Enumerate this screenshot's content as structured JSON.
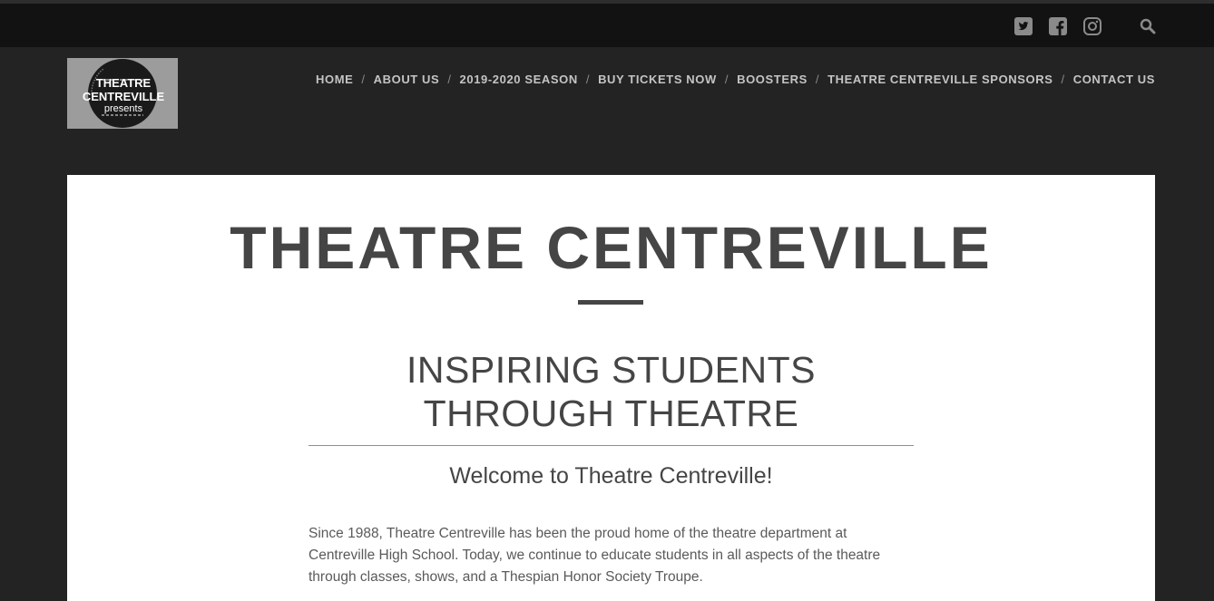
{
  "header": {
    "social": [
      {
        "icon": "twitter-icon"
      },
      {
        "icon": "facebook-icon"
      },
      {
        "icon": "instagram-icon"
      }
    ],
    "search_icon": "search-icon"
  },
  "logo": {
    "line1": "THEATRE",
    "line2": "CENTREVILLE",
    "line3": "presents"
  },
  "nav": {
    "separator": "/",
    "items": [
      "HOME",
      "ABOUT US",
      "2019-2020 SEASON",
      "BUY TICKETS NOW",
      "BOOSTERS",
      "THEATRE CENTREVILLE SPONSORS",
      "CONTACT US"
    ]
  },
  "main": {
    "title": "THEATRE CENTREVILLE",
    "tagline_line1": "INSPIRING STUDENTS",
    "tagline_line2": "THROUGH THEATRE",
    "welcome": "Welcome to Theatre Centreville!",
    "intro": "Since 1988, Theatre Centreville has been the proud home of the theatre department at Centreville High School.  Today, we continue to educate students in all aspects of the theatre through classes, shows, and a Thespian Honor Society Troupe."
  },
  "colors": {
    "page_bg": "#232323",
    "topbar_bg": "#121212",
    "nav_text": "#c4c4c4",
    "heading": "#454545"
  }
}
